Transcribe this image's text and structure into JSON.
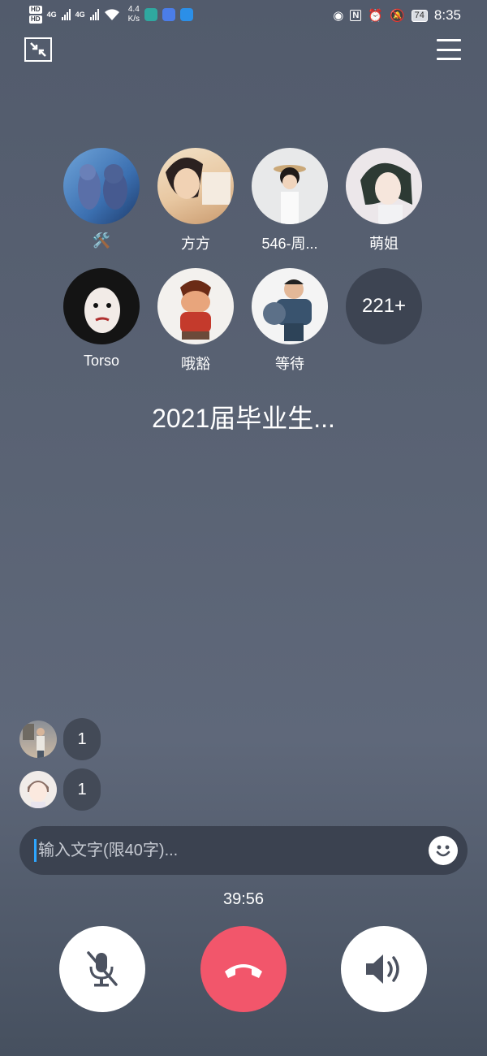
{
  "status_bar": {
    "hd1": "HD",
    "hd2": "HD",
    "net1": "4G",
    "net2": "4G",
    "speed_value": "4.4",
    "speed_unit": "K/s",
    "battery": "74",
    "time": "8:35",
    "icons": [
      "eye-icon",
      "nfc-icon",
      "alarm-icon",
      "mute-bell-icon"
    ]
  },
  "members": [
    {
      "name": "🛠️",
      "avatar": "tom-jerry"
    },
    {
      "name": "方方",
      "avatar": "girl-photo"
    },
    {
      "name": "546-周...",
      "avatar": "child-hat"
    },
    {
      "name": "萌姐",
      "avatar": "anime-girl"
    },
    {
      "name": "Torso",
      "avatar": "sketch-face"
    },
    {
      "name": "哦豁",
      "avatar": "ralph"
    },
    {
      "name": "等待",
      "avatar": "soldier"
    }
  ],
  "more_count": "221+",
  "group_title": "2021届毕业生...",
  "chat": [
    {
      "count": "1",
      "avatar": "person-photo"
    },
    {
      "count": "1",
      "avatar": "cartoon-boy"
    }
  ],
  "input": {
    "placeholder": "输入文字(限40字)..."
  },
  "call_timer": "39:56",
  "colors": {
    "hangup": "#f2566b",
    "background": "#5a6374",
    "caret": "#2ea6ff"
  }
}
